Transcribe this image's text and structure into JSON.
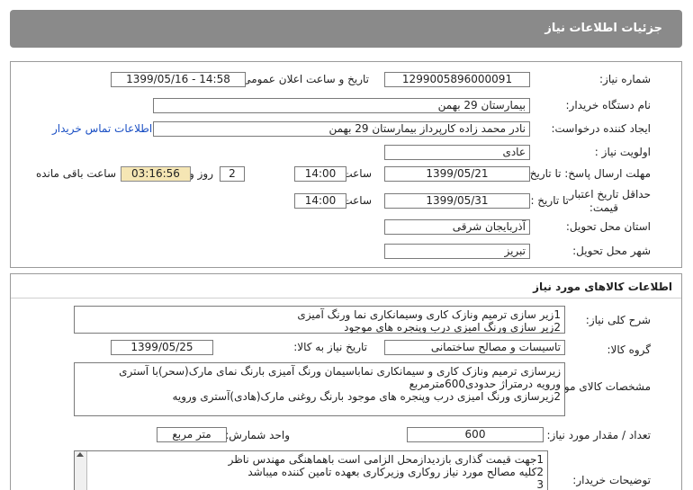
{
  "header": {
    "title": "جزئیات اطلاعات نیاز"
  },
  "need": {
    "need_number_label": "شماره نیاز:",
    "need_number": "1299005896000091",
    "announce_label": "تاریخ و ساعت اعلان عمومی:",
    "announce_value": "1399/05/16 - 14:58",
    "buyer_org_label": "نام دستگاه خریدار:",
    "buyer_org": "بیمارستان 29 بهمن",
    "creator_label": "ایجاد کننده درخواست:",
    "creator": "نادر محمد زاده کارپرداز بیمارستان 29 بهمن",
    "contact_link": "اطلاعات تماس خریدار",
    "priority_label": "اولویت نیاز :",
    "priority": "عادی",
    "send_deadline_label": "مهلت ارسال پاسخ: تا تاریخ :",
    "send_date": "1399/05/21",
    "time_label": "ساعت",
    "send_time": "14:00",
    "day_count": "2",
    "day_and_label": "روز و",
    "remaining": "03:16:56",
    "remaining_label": "ساعت باقی مانده",
    "min_validity_label_1": "حداقل تاریخ اعتبار",
    "min_validity_label_2": "قیمت:",
    "until_date_label": "تا تاریخ :",
    "validity_date": "1399/05/31",
    "validity_time": "14:00",
    "province_label": "استان محل تحویل:",
    "province": "آذربایجان شرقی",
    "city_label": "شهر محل تحویل:",
    "city": "تبریز"
  },
  "goods": {
    "section_title": "اطلاعات کالاهای مورد نیاز",
    "summary_label": "شرح کلی نیاز:",
    "summary_lines": [
      "1زیر سازی ترمیم ونازک کاری وسیمانکاری نما ورنگ آمیزی",
      "2زیر سازی ورنگ امیزی درب وپنجره های موجود"
    ],
    "group_label": "گروه کالا:",
    "group": "تاسیسات و مصالح ساختمانی",
    "need_date_label": "تاریخ نیاز به کالا:",
    "need_date": "1399/05/25",
    "specs_label": "مشخصات کالای مورد نیاز:",
    "specs_lines": [
      "زیرسازی ترمیم ونازک کاری و سیمانکاری نماباسیمان ورنگ آمیزی بارنگ نمای مارک(سحر)با آستری",
      "ورویه درمتراژ حدودی600مترمربع",
      "2زیرسازی ورنگ امیزی درب وپنجره های موجود بارنگ روغنی مارک(هادی)آستری ورویه"
    ],
    "quantity_label": "تعداد / مقدار مورد نیاز:",
    "quantity": "600",
    "unit_label": "واحد شمارش:",
    "unit": "متر مربع",
    "buyer_notes_label": "توضیحات خریدار:",
    "buyer_notes_lines": [
      "1جهت قیمت گذاری بازدیدازمحل الزامی است باهماهنگی مهندس ناظر",
      "2کلیه مصالح مورد نیاز روکاری وزیرکاری بعهده تامین کننده میباشد",
      "3"
    ]
  }
}
